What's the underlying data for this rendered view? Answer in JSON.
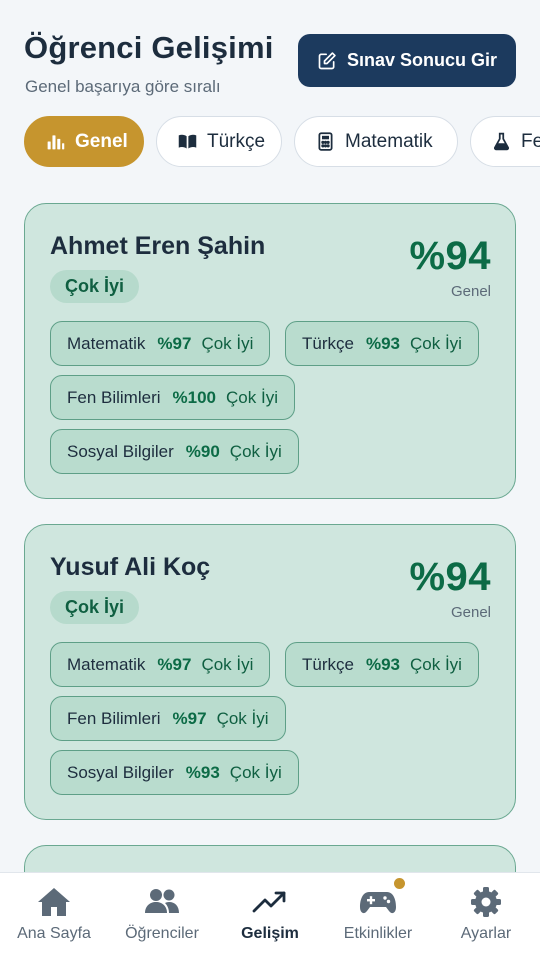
{
  "header": {
    "title": "Öğrenci Gelişimi",
    "subtitle": "Genel başarıya göre sıralı",
    "enter_button": "Sınav Sonucu Gir"
  },
  "tabs": [
    {
      "label": "Genel",
      "icon": "bar-chart-icon",
      "active": true
    },
    {
      "label": "Türkçe",
      "icon": "book-icon",
      "active": false
    },
    {
      "label": "Matematik",
      "icon": "calculator-icon",
      "active": false
    },
    {
      "label": "Fen",
      "icon": "flask-icon",
      "active": false
    }
  ],
  "students": [
    {
      "name": "Ahmet Eren Şahin",
      "level": "Çok İyi",
      "score": "%94",
      "score_label": "Genel",
      "subjects": [
        {
          "name": "Matematik",
          "pct": "%97",
          "level": "Çok İyi"
        },
        {
          "name": "Türkçe",
          "pct": "%93",
          "level": "Çok İyi"
        },
        {
          "name": "Fen Bilimleri",
          "pct": "%100",
          "level": "Çok İyi"
        },
        {
          "name": "Sosyal Bilgiler",
          "pct": "%90",
          "level": "Çok İyi"
        }
      ]
    },
    {
      "name": "Yusuf Ali Koç",
      "level": "Çok İyi",
      "score": "%94",
      "score_label": "Genel",
      "subjects": [
        {
          "name": "Matematik",
          "pct": "%97",
          "level": "Çok İyi"
        },
        {
          "name": "Türkçe",
          "pct": "%93",
          "level": "Çok İyi"
        },
        {
          "name": "Fen Bilimleri",
          "pct": "%97",
          "level": "Çok İyi"
        },
        {
          "name": "Sosyal Bilgiler",
          "pct": "%93",
          "level": "Çok İyi"
        }
      ]
    }
  ],
  "bottom_nav": [
    {
      "label": "Ana Sayfa",
      "icon": "home-icon",
      "active": false
    },
    {
      "label": "Öğrenciler",
      "icon": "users-icon",
      "active": false
    },
    {
      "label": "Gelişim",
      "icon": "trend-icon",
      "active": true
    },
    {
      "label": "Etkinlikler",
      "icon": "gamepad-icon",
      "active": false,
      "badge": true
    },
    {
      "label": "Ayarlar",
      "icon": "gear-icon",
      "active": false
    }
  ],
  "colors": {
    "primary": "#1c3a5e",
    "accent": "#c6952e",
    "card_bg": "#cfe6de",
    "success": "#0c6b46"
  }
}
